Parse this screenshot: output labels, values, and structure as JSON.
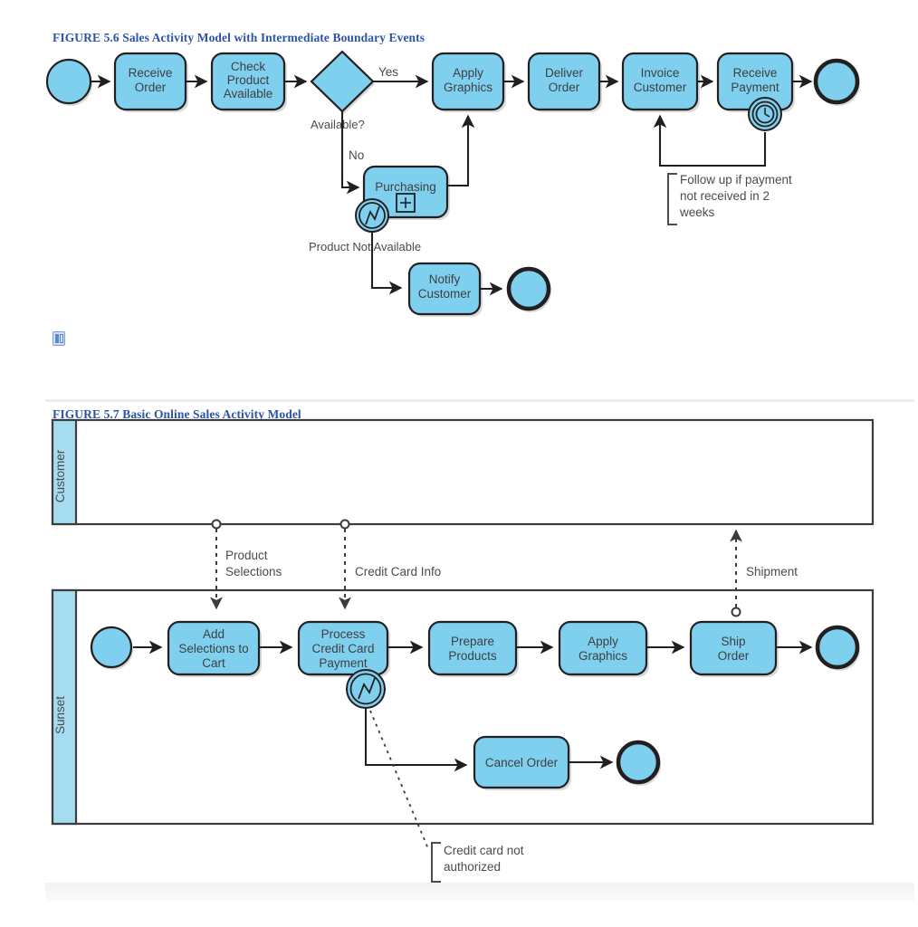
{
  "figures": [
    {
      "id": "fig-5-6",
      "title": "FIGURE 5.6 Sales Activity Model with Intermediate Boundary Events",
      "nodes": {
        "start": "",
        "receive_order": "Receive\nOrder",
        "check_product": "Check\nProduct\nAvailable",
        "gateway": "",
        "apply_graphics": "Apply\nGraphics",
        "deliver_order": "Deliver\nOrder",
        "invoice_customer": "Invoice\nCustomer",
        "receive_payment": "Receive\nPayment",
        "purchasing": "Purchasing",
        "notify_customer": "Notify\nCustomer"
      },
      "node_lines": {
        "receive_order": [
          "Receive",
          "Order"
        ],
        "check_product": [
          "Check",
          "Product",
          "Available"
        ],
        "apply_graphics": [
          "Apply",
          "Graphics"
        ],
        "deliver_order": [
          "Deliver",
          "Order"
        ],
        "invoice_customer": [
          "Invoice",
          "Customer"
        ],
        "receive_payment": [
          "Receive",
          "Payment"
        ],
        "purchasing": [
          "Purchasing"
        ],
        "notify_customer": [
          "Notify",
          "Customer"
        ]
      },
      "labels": {
        "gateway_question": "Available?",
        "flow_yes": "Yes",
        "flow_no": "No",
        "error_label": "Product Not Available",
        "subprocess_marker": "+"
      },
      "annotation": {
        "lines": [
          "Follow up if payment",
          "not received in 2",
          "weeks"
        ]
      },
      "boundary_events": [
        {
          "attached_to": "receive_payment",
          "type": "timer-event-icon"
        },
        {
          "attached_to": "purchasing",
          "type": "error-event-icon"
        }
      ]
    },
    {
      "id": "fig-5-7",
      "title": "FIGURE 5.7 Basic Online Sales Activity Model",
      "lanes": [
        {
          "name": "customer-lane",
          "label": "Customer"
        },
        {
          "name": "sunset-lane",
          "label": "Sunset"
        }
      ],
      "node_lines": {
        "add_selections": [
          "Add",
          "Selections to",
          "Cart"
        ],
        "process_payment": [
          "Process",
          "Credit Card",
          "Payment"
        ],
        "prepare_products": [
          "Prepare",
          "Products"
        ],
        "apply_graphics": [
          "Apply",
          "Graphics"
        ],
        "ship_order": [
          "Ship",
          "Order"
        ],
        "cancel_order": [
          "Cancel Order"
        ]
      },
      "message_flows": [
        {
          "name": "product-selections-flow",
          "label": "Product Selections",
          "lines": [
            "Product",
            "Selections"
          ]
        },
        {
          "name": "credit-card-info-flow",
          "label": "Credit Card Info",
          "lines": [
            "Credit Card Info"
          ]
        },
        {
          "name": "shipment-flow",
          "label": "Shipment",
          "lines": [
            "Shipment"
          ]
        }
      ],
      "annotation": {
        "lines": [
          "Credit card not",
          "authorized"
        ]
      },
      "boundary_events": [
        {
          "attached_to": "process_payment",
          "type": "error-event-icon"
        }
      ]
    }
  ],
  "colors": {
    "shape_fill": "#7ed0ee",
    "lane_header_fill": "#a5dcf2",
    "outline": "#231f20",
    "title_blue": "#2b54a8",
    "text_gray": "#4b4b4b"
  },
  "misc": {
    "broken_image_placeholder": "broken-image-icon"
  }
}
